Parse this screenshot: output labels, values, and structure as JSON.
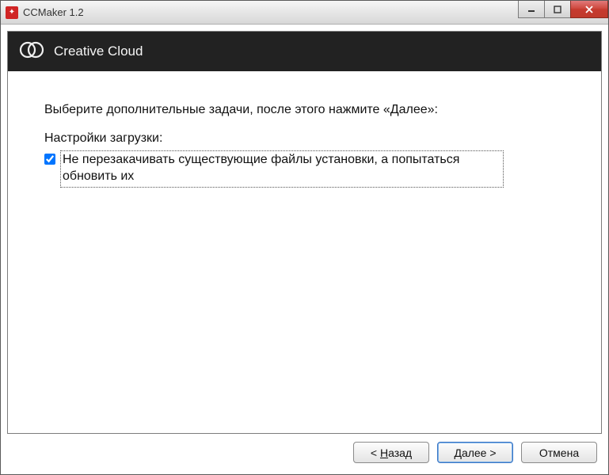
{
  "window": {
    "title": "CCMaker 1.2"
  },
  "header": {
    "title": "Creative Cloud"
  },
  "content": {
    "instruction": "Выберите дополнительные задачи, после этого нажмите «Далее»:",
    "section_label": "Настройки загрузки:",
    "checkbox_label": "Не перезакачивать существующие файлы установки, а попытаться обновить их",
    "checkbox_checked": true
  },
  "buttons": {
    "back_prefix": "< ",
    "back_u": "Н",
    "back_rest": "азад",
    "next_u": "Д",
    "next_rest": "алее >",
    "cancel": "Отмена"
  }
}
